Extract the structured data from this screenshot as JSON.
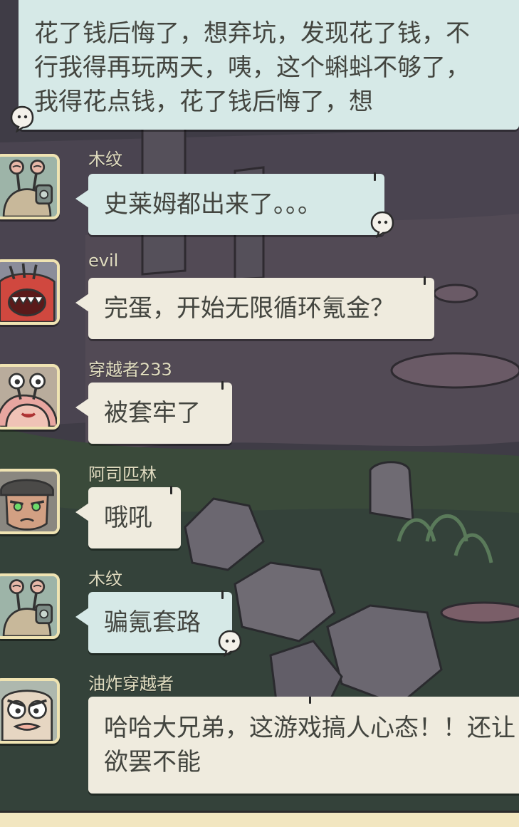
{
  "messages": [
    {
      "id": "m0",
      "author": "",
      "text": "花了钱后悔了，想弃坑，发现花了钱，不行我得再玩两天，咦，这个蝌蚪不够了，我得花点钱，花了钱后悔了，想",
      "style": "blue",
      "line1": "花了钱后悔了，想弃坑，发现花了钱，不",
      "line2": "行我得再玩两天，咦，这个蝌蚪不够了，",
      "line3": "我得花点钱，花了钱后悔了，想",
      "avatar_icon": "snail-icon"
    },
    {
      "id": "m1",
      "author": "木纹",
      "text": "史莱姆都出来了。。。",
      "style": "blue",
      "avatar_icon": "snail-goggles-avatar"
    },
    {
      "id": "m2",
      "author": "evil",
      "text": "完蛋，开始无限循环氪金？",
      "style": "cream",
      "avatar_icon": "red-monster-avatar"
    },
    {
      "id": "m3",
      "author": "穿越者233",
      "text": "被套牢了",
      "style": "cream",
      "avatar_icon": "pink-snail-avatar"
    },
    {
      "id": "m4",
      "author": "阿司匹林",
      "text": "哦吼",
      "style": "cream",
      "avatar_icon": "green-eyed-man-avatar"
    },
    {
      "id": "m5",
      "author": "木纹",
      "text": "骗氪套路",
      "style": "blue",
      "avatar_icon": "snail-goggles-avatar"
    },
    {
      "id": "m6",
      "author": "油炸穿越者",
      "text": "哈哈大兄弟，这游戏搞人心态！！还让",
      "text2": "欲罢不能",
      "style": "cream",
      "avatar_icon": "angry-old-man-avatar"
    }
  ],
  "colors": {
    "bubble_blue": "#d6e9e7",
    "bubble_cream": "#efebde",
    "name_text": "#e0dcc0",
    "background": "#3d3a43"
  }
}
